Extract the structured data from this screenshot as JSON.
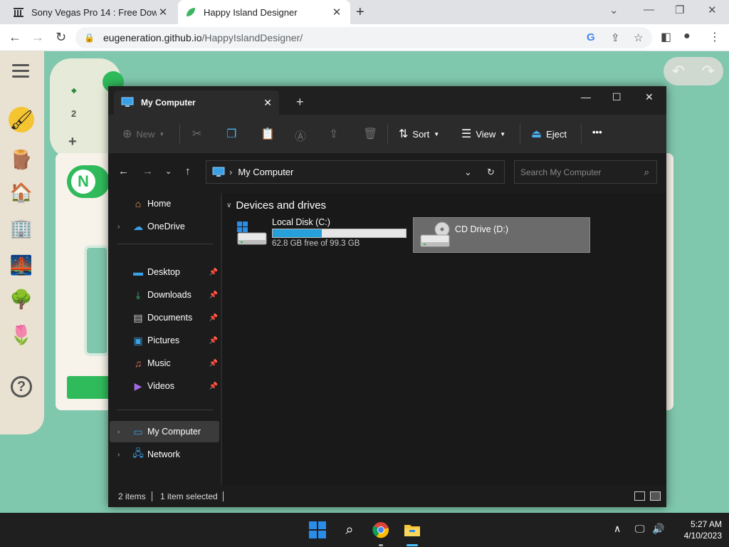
{
  "browser": {
    "tabs": [
      {
        "title": "Sony Vegas Pro 14 : Free Downlo",
        "icon": "archive-icon"
      },
      {
        "title": "Happy Island Designer",
        "icon": "leaf-icon",
        "active": true
      }
    ],
    "url_host": "eugeneration.github.io",
    "url_path": "/HappyIslandDesigner/"
  },
  "island": {
    "panel_count": "2",
    "logo_letter": "N",
    "tools": [
      "hamburger-menu-icon",
      "paint-brush-icon",
      "log-icon",
      "house-icon",
      "building-icon",
      "bridge-icon",
      "tree-icon",
      "tulip-icon",
      "help-icon"
    ]
  },
  "explorer": {
    "tab_title": "My Computer",
    "toolbar": {
      "new": "New",
      "sort": "Sort",
      "view": "View",
      "eject": "Eject",
      "more": "•••"
    },
    "address": "My Computer",
    "search_placeholder": "Search My Computer",
    "nav": {
      "home": "Home",
      "onedrive": "OneDrive",
      "desktop": "Desktop",
      "downloads": "Downloads",
      "documents": "Documents",
      "pictures": "Pictures",
      "music": "Music",
      "videos": "Videos",
      "my_computer": "My Computer",
      "network": "Network"
    },
    "group_title": "Devices and drives",
    "drives": [
      {
        "name": "Local Disk (C:)",
        "free_text": "62.8 GB free of 99.3 GB",
        "used_fraction": 0.368
      },
      {
        "name": "CD Drive (D:)"
      }
    ],
    "status": {
      "items": "2 items",
      "selected": "1 item selected"
    }
  },
  "taskbar": {
    "time": "5:27 AM",
    "date": "4/10/2023"
  },
  "colors": {
    "accent_blue": "#26a0da",
    "island_green": "#2fba5b",
    "island_bg": "#7fc7ad"
  }
}
